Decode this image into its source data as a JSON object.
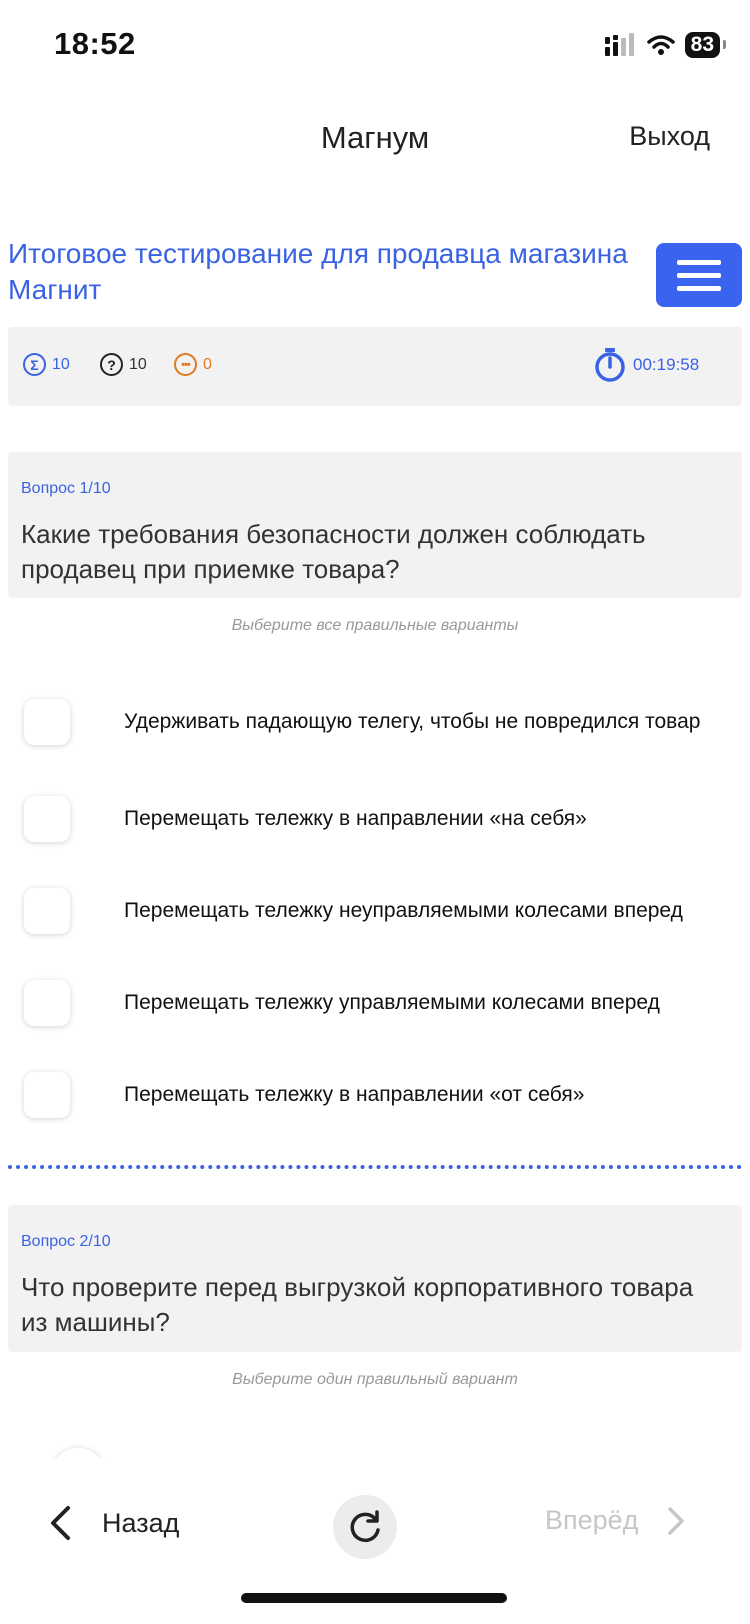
{
  "status_bar": {
    "time": "18:52",
    "battery": "83"
  },
  "header": {
    "title": "Магнум",
    "exit_label": "Выход"
  },
  "test": {
    "title": " Итоговое тестирование для продавца магазина Магнит"
  },
  "stats": {
    "total": "10",
    "questions": "10",
    "skipped": "0",
    "timer": "00:19:58"
  },
  "colors": {
    "accent": "#3a63e4",
    "button": "#3a63f0",
    "skipped": "#e07a1f",
    "card_bg": "#f2f2f2"
  },
  "questions": [
    {
      "number": "Вопрос 1/10",
      "text": "Какие требования безопасности должен соблюдать продавец при приемке товара?",
      "hint": "Выберите все правильные варианты",
      "options": [
        "Удерживать падающую телегу, чтобы не повредился товар",
        "Перемещать тележку в направлении «на себя»",
        "Перемещать тележку неуправляемыми колесами вперед",
        "Перемещать тележку управляемыми колесами вперед",
        "Перемещать тележку в направлении «от себя»"
      ]
    },
    {
      "number": "Вопрос 2/10",
      "text": "Что проверите перед выгрузкой корпоративного товара из машины?",
      "hint": "Выберите один правильный вариант"
    }
  ],
  "footer": {
    "back_label": "Назад",
    "forward_label": "Вперёд"
  },
  "icons": [
    "signal-icon",
    "wifi-icon",
    "battery-icon",
    "menu-icon",
    "sum-icon",
    "question-icon",
    "more-icon",
    "stopwatch-icon",
    "chevron-left-icon",
    "refresh-icon",
    "chevron-right-icon"
  ]
}
